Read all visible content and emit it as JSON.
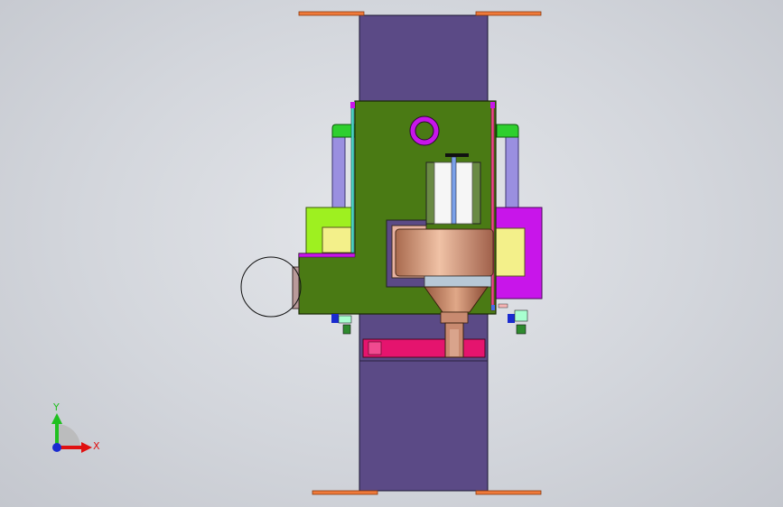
{
  "viewport": {
    "background": "#d3d6dc"
  },
  "colors": {
    "plate_purple": "#5b4a86",
    "base_green": "#4a7a14",
    "lime": "#9ef020",
    "magenta": "#c815ea",
    "copper": "#d59a7e",
    "pink": "#e5146e",
    "orange_rail": "#f07a3a",
    "yellow": "#f3f08a",
    "lavender": "#9a8fe0",
    "green_fitting": "#2ecf2e",
    "axis_x": "#e01010",
    "axis_y": "#20c020",
    "axis_z": "#1a2bd0"
  },
  "triad": {
    "x_label": "X",
    "y_label": "Y",
    "icon": "coordinate-triad-icon"
  }
}
